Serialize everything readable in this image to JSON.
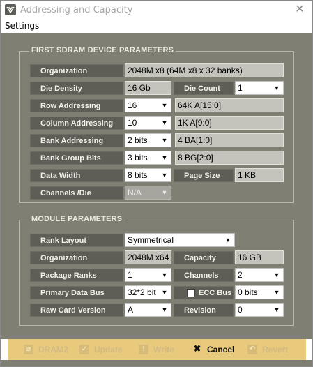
{
  "window": {
    "title": "Addressing and Capacity",
    "close_glyph": "✕"
  },
  "menu": {
    "settings": "Settings"
  },
  "sdram": {
    "title": "FIRST SDRAM DEVICE PARAMETERS",
    "organization": {
      "label": "Organization",
      "value": "2048M x8 (64M x8 x 32 banks)"
    },
    "die_density": {
      "label": "Die Density",
      "value": "16 Gb"
    },
    "die_count": {
      "label": "Die Count",
      "value": "1"
    },
    "row_addressing": {
      "label": "Row Addressing",
      "value": "16",
      "info": "64K A[15:0]"
    },
    "column_addressing": {
      "label": "Column Addressing",
      "value": "10",
      "info": "1K A[9:0]"
    },
    "bank_addressing": {
      "label": "Bank Addressing",
      "value": "2 bits",
      "info": "4 BA[1:0]"
    },
    "bank_group_bits": {
      "label": "Bank Group Bits",
      "value": "3 bits",
      "info": "8 BG[2:0]"
    },
    "data_width": {
      "label": "Data Width",
      "value": "8 bits"
    },
    "page_size": {
      "label": "Page Size",
      "value": "1 KB"
    },
    "channels_die": {
      "label": "Channels /Die",
      "value": "N/A"
    }
  },
  "module": {
    "title": "MODULE PARAMETERS",
    "rank_layout": {
      "label": "Rank Layout",
      "value": "Symmetrical"
    },
    "organization": {
      "label": "Organization",
      "value": "2048M x64"
    },
    "capacity": {
      "label": "Capacity",
      "value": "16 GB"
    },
    "package_ranks": {
      "label": "Package Ranks",
      "value": "1"
    },
    "channels": {
      "label": "Channels",
      "value": "2"
    },
    "primary_data_bus": {
      "label": "Primary Data Bus",
      "value": "32*2 bit"
    },
    "ecc_bus": {
      "label": "ECC Bus",
      "value": "0 bits",
      "checked": false
    },
    "raw_card_version": {
      "label": "Raw Card Version",
      "value": "A"
    },
    "revision": {
      "label": "Revision",
      "value": "0"
    }
  },
  "toolbar": {
    "dram2": {
      "label": "DRAM2",
      "icon": "link-icon",
      "enabled": false
    },
    "update": {
      "label": "Update",
      "icon": "checkmark-icon",
      "enabled": false
    },
    "write": {
      "label": "Write",
      "icon": "exclamation-icon",
      "enabled": false
    },
    "cancel": {
      "label": "Cancel",
      "icon": "close-icon",
      "enabled": true
    },
    "revert": {
      "label": "Revert",
      "icon": "undo-icon",
      "enabled": false
    }
  },
  "colors": {
    "panel": "#7f7f73",
    "label_bg": "#5e5e57",
    "field_bg": "#c4c4bc",
    "toolbar_bg": "#e9c97b"
  }
}
